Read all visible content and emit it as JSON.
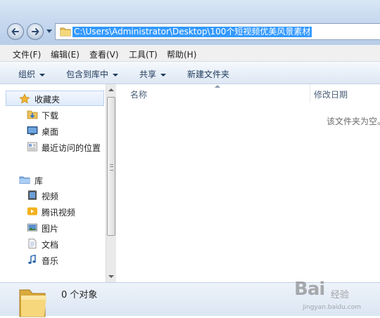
{
  "address": {
    "path": "C:\\Users\\Administrator\\Desktop\\100个短视频优美风景素材"
  },
  "menu": [
    "文件(F)",
    "编辑(E)",
    "查看(V)",
    "工具(T)",
    "帮助(H)"
  ],
  "toolbar": {
    "organize": "组织",
    "include_library": "包含到库中",
    "share": "共享",
    "new_folder": "新建文件夹"
  },
  "nav": {
    "favorites": {
      "label": "收藏夹",
      "items": [
        "下载",
        "桌面",
        "最近访问的位置"
      ]
    },
    "libraries": {
      "label": "库",
      "items": [
        "视频",
        "腾讯视频",
        "图片",
        "文档",
        "音乐"
      ]
    }
  },
  "content": {
    "columns": {
      "name": "名称",
      "date_modified": "修改日期"
    },
    "empty_message": "该文件夹为空。"
  },
  "details": {
    "count": "0 个对象"
  },
  "watermark": {
    "brand": "Bai",
    "brand2": "经验",
    "url": "jingyan.baidu.com"
  },
  "colors": {
    "selection": "#3399ff",
    "accent": "#1e395b"
  }
}
